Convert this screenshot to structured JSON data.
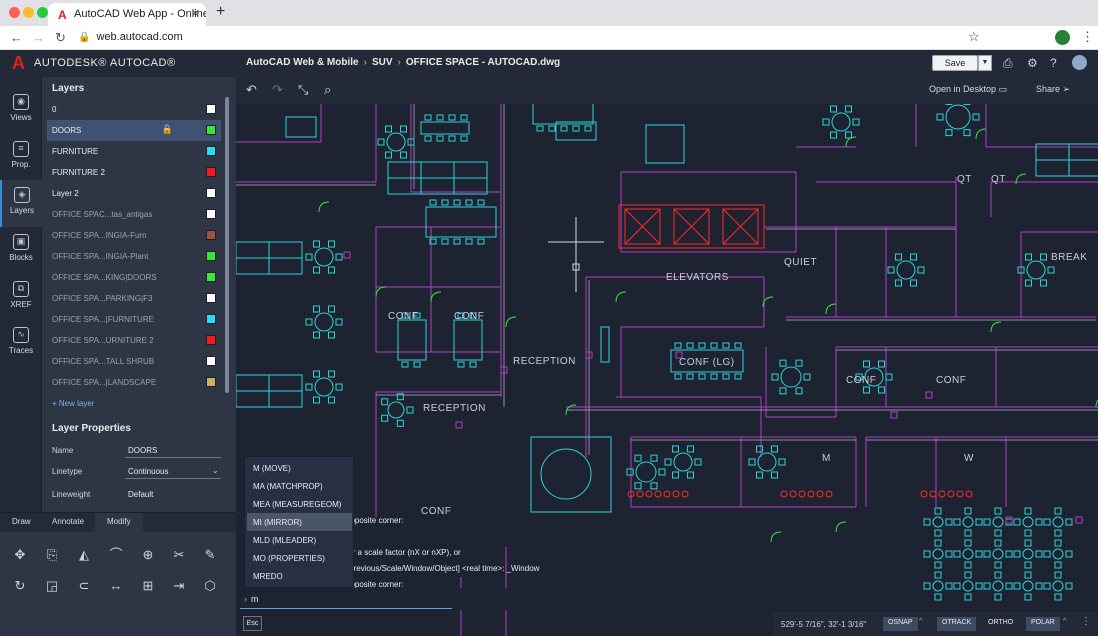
{
  "browser": {
    "tab_title": "AutoCAD Web App - Online CA",
    "tab_close": "✕",
    "new_tab": "+",
    "url": "web.autocad.com",
    "dot_colors": [
      "#fe5f57",
      "#febc2e",
      "#28c840"
    ]
  },
  "header": {
    "brand": "AUTODESK® AUTOCAD®",
    "breadcrumb": [
      "AutoCAD Web & Mobile",
      "SUV",
      "OFFICE SPACE - AUTOCAD.dwg"
    ],
    "save_label": "Save"
  },
  "rail": {
    "items": [
      {
        "label": "Views",
        "icon": "eye-icon"
      },
      {
        "label": "Prop.",
        "icon": "properties-icon"
      },
      {
        "label": "Layers",
        "icon": "layers-icon"
      },
      {
        "label": "Blocks",
        "icon": "blocks-icon"
      },
      {
        "label": "XREF",
        "icon": "xref-icon"
      },
      {
        "label": "Traces",
        "icon": "traces-icon"
      }
    ],
    "active": "Layers"
  },
  "layers": {
    "title": "Layers",
    "items": [
      {
        "name": "0",
        "color": "#ffffff"
      },
      {
        "name": "DOORS",
        "color": "#39e63a",
        "locked": true,
        "selected": true
      },
      {
        "name": "FURNITURE",
        "color": "#29d9f2"
      },
      {
        "name": "FURNITURE 2",
        "color": "#f51b1b"
      },
      {
        "name": "Layer 2",
        "color": "#ffffff"
      },
      {
        "name": "OFFICE SPAC...tas_antigas",
        "color": "#ffffff",
        "dim": true
      },
      {
        "name": "OFFICE SPA...INGIA-Furn",
        "color": "#a0523a",
        "dim": true
      },
      {
        "name": "OFFICE SPA...INGIA-Plant",
        "color": "#39e63a",
        "dim": true
      },
      {
        "name": "OFFICE SPA...KING|DOORS",
        "color": "#39e63a",
        "dim": true
      },
      {
        "name": "OFFICE SPA...PARKING|F3",
        "color": "#ffffff",
        "dim": true
      },
      {
        "name": "OFFICE SPA...|FURNITURE",
        "color": "#29d9f2",
        "dim": true
      },
      {
        "name": "OFFICE SPA...URNITURE 2",
        "color": "#f51b1b",
        "dim": true
      },
      {
        "name": "OFFICE SPA...TALL SHRUB",
        "color": "#ffffff",
        "dim": true
      },
      {
        "name": "OFFICE SPA...|LANDSCAPE",
        "color": "#c8b06a",
        "dim": true
      }
    ],
    "new_layer": "+ New layer"
  },
  "layer_properties": {
    "title": "Layer Properties",
    "name_label": "Name",
    "name_value": "DOORS",
    "linetype_label": "Linetype",
    "linetype_value": "Continuous",
    "lineweight_label": "Lineweight",
    "lineweight_value": "Default"
  },
  "tools": {
    "tabs": [
      "Draw",
      "Annotate",
      "Modify"
    ],
    "active_tab": "Modify"
  },
  "canvas_toolbar": {
    "open_in_desktop": "Open in Desktop",
    "share": "Share"
  },
  "drawing_labels": [
    "ELEVATORS",
    "QUIET",
    "BREAK",
    "QT",
    "QT",
    "RECEPTION",
    "RECEPTION",
    "CONF",
    "CONF",
    "CONF (LG)",
    "CONF",
    "CONF",
    "M",
    "W",
    "CONF"
  ],
  "command": {
    "suggestions": [
      "M (MOVE)",
      "MA (MATCHPROP)",
      "MEA (MEASUREGEOM)",
      "MI (MIRROR)",
      "MLD (MLEADER)",
      "MO (PROPERTIES)",
      "MREDO"
    ],
    "selected_suggestion": "MI (MIRROR)",
    "history": [
      "opposite corner:",
      "ter a scale factor (nX or nXP), or",
      "/Previous/Scale/Window/Object] <real time>: _Window",
      "opposite corner:"
    ],
    "prompt": "›",
    "input_value": "m",
    "esc_label": "Esc"
  },
  "status": {
    "coordinates": "529'-5 7/16\", 32'-1 3/16\"",
    "toggles": [
      "OSNAP",
      "OTRACK",
      "ORTHO",
      "POLAR"
    ]
  },
  "colors": {
    "wall": "#b23ec9",
    "furniture": "#2fd3d6",
    "door": "#39e63a",
    "red": "#ff2a2a",
    "accent": "#3a8fd6"
  }
}
